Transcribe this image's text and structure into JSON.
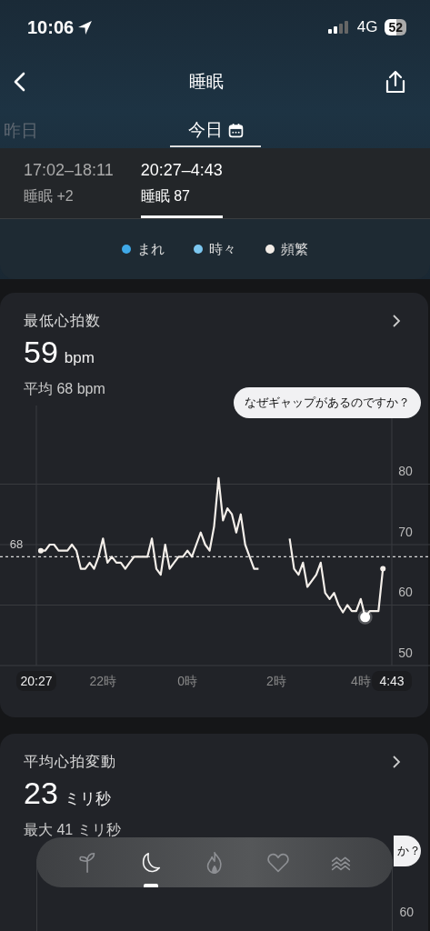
{
  "status_bar": {
    "time": "10:06",
    "network": "4G",
    "battery": "52"
  },
  "nav": {
    "title": "睡眠"
  },
  "day_tabs": [
    {
      "label": "昨日",
      "selected": false
    },
    {
      "label": "今日",
      "selected": true
    }
  ],
  "sessions": [
    {
      "time": "17:02–18:11",
      "label": "睡眠 +2",
      "selected": false
    },
    {
      "time": "20:27–4:43",
      "label": "睡眠 87",
      "selected": true
    }
  ],
  "legend": [
    {
      "label": "まれ",
      "color": "#3fa9e8"
    },
    {
      "label": "時々",
      "color": "#7cc7f0"
    },
    {
      "label": "頻繁",
      "color": "#f2ece6"
    }
  ],
  "min_hr_card": {
    "title": "最低心拍数",
    "value": "59",
    "unit": "bpm",
    "average": "平均 68 bpm",
    "bubble": "なぜギャップがあるのですか？",
    "chart_data": {
      "type": "line",
      "categories": [
        "20:27",
        null,
        null,
        null,
        null,
        null,
        null,
        null,
        null,
        null,
        null,
        null,
        null,
        null,
        null,
        "22時",
        null,
        null,
        null,
        null,
        null,
        null,
        null,
        null,
        null,
        null,
        null,
        null,
        null,
        null,
        null,
        null,
        null,
        null,
        "0時",
        null,
        null,
        null,
        null,
        null,
        null,
        null,
        null,
        null,
        null,
        null,
        null,
        null,
        null,
        null,
        null,
        null,
        null,
        null,
        "2時",
        null,
        null,
        null,
        null,
        null,
        null,
        null,
        null,
        null,
        null,
        null,
        null,
        null,
        null,
        null,
        null,
        null,
        null,
        "4時",
        null,
        null,
        null,
        null,
        null,
        null,
        "4:43"
      ],
      "series": [
        {
          "color": "#f4efea",
          "values": [
            null,
            69,
            69,
            70,
            70,
            69,
            69,
            69,
            70,
            69,
            66,
            66,
            67,
            66,
            68,
            71,
            67,
            68,
            67,
            67,
            66,
            67,
            68,
            68,
            68,
            68,
            71,
            66,
            65,
            70,
            66,
            67,
            68,
            68,
            69,
            68,
            70,
            72,
            70,
            69,
            73,
            81,
            74,
            76,
            75,
            72,
            75,
            70,
            68,
            66,
            66,
            null,
            null,
            null,
            null,
            null,
            null,
            71,
            66,
            65,
            67,
            63,
            64,
            65,
            67,
            62,
            61,
            62,
            60,
            58.8,
            60,
            59,
            59,
            61,
            58,
            59,
            59,
            59,
            66,
            null,
            null
          ]
        }
      ],
      "ylim": [
        50,
        93
      ],
      "yticks": [
        80,
        70,
        60,
        50
      ],
      "grid": true,
      "ref_lines": [
        {
          "axis": "y",
          "value": 68,
          "label": "68"
        }
      ]
    }
  },
  "hrv_card": {
    "title": "平均心拍変動",
    "value": "23",
    "unit": "ミリ秒",
    "max": "最大 41 ミリ秒",
    "bubble": "か？",
    "axis_label": "60"
  },
  "tab_bar": [
    {
      "selected": false
    },
    {
      "selected": true
    },
    {
      "selected": false
    },
    {
      "selected": false
    },
    {
      "selected": false
    }
  ]
}
